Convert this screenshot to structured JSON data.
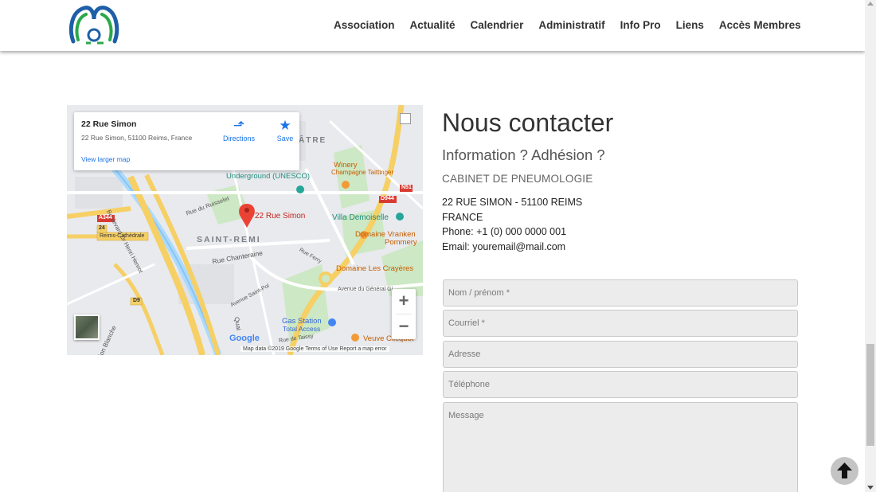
{
  "nav": {
    "items": [
      "Association",
      "Actualité",
      "Calendrier",
      "Administratif",
      "Info Pro",
      "Liens",
      "Accès Membres"
    ]
  },
  "map": {
    "card_title": "22 Rue Simon",
    "card_address": "22 Rue Simon, 51100 Reims, France",
    "directions": "Directions",
    "save": "Save",
    "view_larger": "View larger map",
    "pin_label": "22 Rue Simon",
    "attribution": "Map data ©2019 Google   Terms of Use   Report a map error",
    "google": "Google",
    "zoom_in": "+",
    "zoom_out": "−",
    "labels": {
      "saint_remi": "SAINT-REMI",
      "atre": "ÂTRE",
      "underground": "Underground (UNESCO)",
      "winery": "Winery",
      "taittinger": "Champagne Taittinger",
      "villa": "Villa Demoiselle",
      "vranken": "Domaine Vranken",
      "pommery": "Pommery",
      "crayeres": "Domaine Les Crayères",
      "gas": "Gas Station",
      "total": "Total Access",
      "veuve": "Veuve Clicquot",
      "chanteraine": "Rue Chanteraine",
      "ruisselet": "Rue du Ruisselet",
      "henrot": "Boulevard Dr Henri Henrot",
      "a344": "A344",
      "d944": "D944",
      "n51": "N51",
      "d9": "D9",
      "n24": "24",
      "reims_cath": "Reims-Cathédrale",
      "general": "Avenue du Général Gi",
      "saintpol": "Avenue Saint-Pol",
      "taissy": "Rue de Taissy",
      "ferry": "Rue Ferry",
      "blanche": "ion Blanche",
      "quai": "Quai"
    }
  },
  "contact": {
    "title": "Nous contacter",
    "subtitle": "Information ? Adhésion ?",
    "org": "CABINET DE PNEUMOLOGIE",
    "address_line": "22 RUE SIMON - 51100 REIMS",
    "country": "FRANCE",
    "phone": "Phone: +1 (0) 000 0000 001",
    "email": "Email: youremail@mail.com"
  },
  "form": {
    "name_placeholder": "Nom / prénom *",
    "email_placeholder": "Courriel *",
    "address_placeholder": "Adresse",
    "phone_placeholder": "Téléphone",
    "message_placeholder": "Message"
  },
  "colors": {
    "logo_blue": "#1e5fa8",
    "logo_green": "#2aa84a",
    "link_blue": "#1a73e8",
    "pin_red": "#ea4335"
  }
}
